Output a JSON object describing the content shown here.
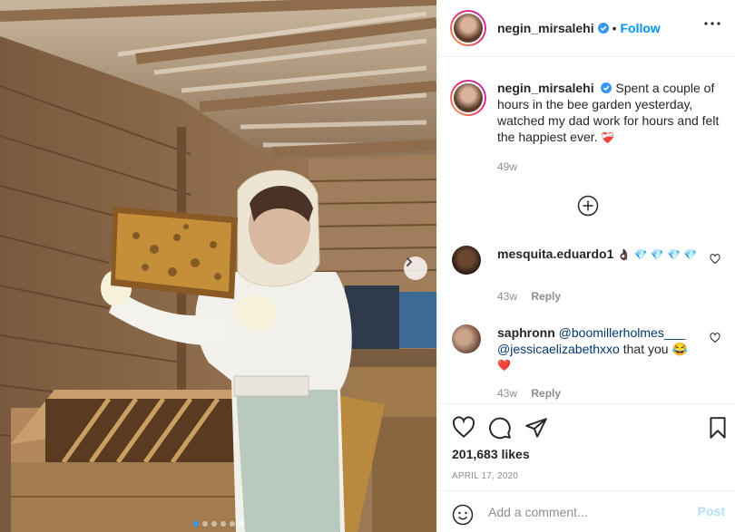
{
  "post": {
    "username": "negin_mirsalehi",
    "verified": true,
    "separator": "•",
    "follow_label": "Follow",
    "caption": "Spent a couple of hours in the bee garden yesterday, watched my dad work for hours and felt the happiest ever.",
    "caption_emoji": "❤️‍🩹",
    "caption_time": "49w",
    "likes": "201,683 likes",
    "date": "APRIL 17, 2020",
    "carousel": {
      "total": 6,
      "active": 1
    }
  },
  "comments": [
    {
      "username": "mesquita.eduardo1",
      "text": "👌🏿 💎 💎 💎 💎",
      "time": "43w",
      "reply_label": "Reply"
    },
    {
      "username": "saphronn",
      "mention1": "@boomillerholmes___",
      "mention2": "@jessicaelizabethxxo",
      "text": "that you 😂",
      "emoji_line": "❤️",
      "time": "43w",
      "reply_label": "Reply"
    }
  ],
  "add_comment": {
    "placeholder": "Add a comment...",
    "post_label": "Post"
  },
  "colors": {
    "link_blue": "#0095f6",
    "post_disabled": "#b2dffc",
    "muted": "#8e8e8e",
    "verified": "#3897f0"
  }
}
